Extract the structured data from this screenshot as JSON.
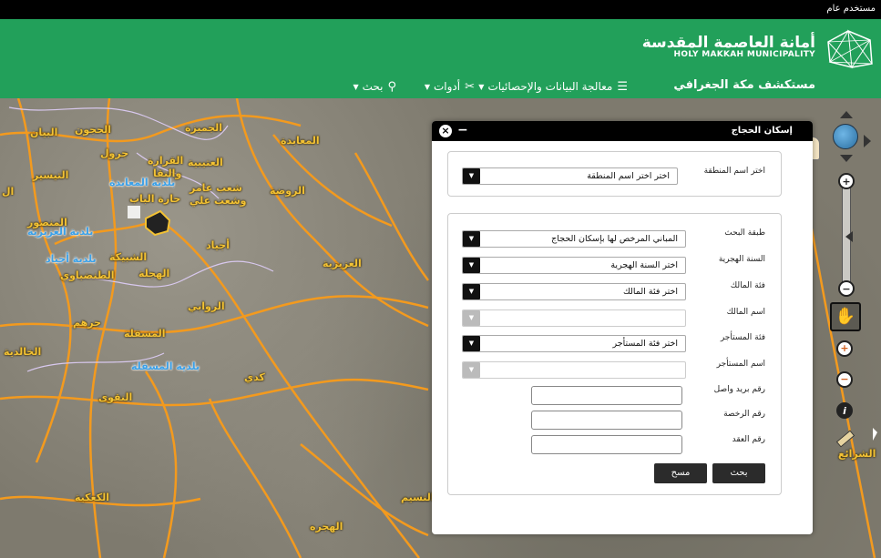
{
  "top_bar": {
    "user": "مستخدم عام"
  },
  "header": {
    "logo_ar": "أمانة العاصمة المقدسة",
    "logo_en": "HOLY MAKKAH MUNICIPALITY",
    "app_title": "مستكشف مكة الجغرافي",
    "nav": [
      {
        "label": "معالجة البيانات والإحصائيات",
        "icon": "database-icon"
      },
      {
        "label": "أدوات",
        "icon": "tools-icon"
      },
      {
        "label": "بحث",
        "icon": "search-icon"
      }
    ],
    "brand_color": "#22a05a"
  },
  "map": {
    "labels": [
      {
        "text": "الحجون"
      },
      {
        "text": "البيان"
      },
      {
        "text": "الجميزة"
      },
      {
        "text": "المعابدة"
      },
      {
        "text": "جرول"
      },
      {
        "text": "القرارة"
      },
      {
        "text": "والنقا"
      },
      {
        "text": "العتيبية"
      },
      {
        "text": "بلدية المعابدة"
      },
      {
        "text": "شعب عامر"
      },
      {
        "text": "وشعب علي"
      },
      {
        "text": "الروضة"
      },
      {
        "text": "التيسير"
      },
      {
        "text": "بلدية العزيزية"
      },
      {
        "text": "بلدية أجياد"
      },
      {
        "text": "حارة الباب"
      },
      {
        "text": "أجياد"
      },
      {
        "text": "المنصور"
      },
      {
        "text": "الشبيكة"
      },
      {
        "text": "الهجلة"
      },
      {
        "text": "الطنضباوي"
      },
      {
        "text": "العزيزية"
      },
      {
        "text": "الروابي"
      },
      {
        "text": "جرهم"
      },
      {
        "text": "المسفلة"
      },
      {
        "text": "بلدية المسفلة"
      },
      {
        "text": "كدي"
      },
      {
        "text": "الخالدية"
      },
      {
        "text": "النقوى"
      },
      {
        "text": "الكعكية"
      },
      {
        "text": "النسيم"
      },
      {
        "text": "الهجره"
      },
      {
        "text": "الشرائع"
      },
      {
        "text": "ال"
      }
    ]
  },
  "dialog": {
    "title": "إسكان الحجاج",
    "close": "×",
    "minimize": "−",
    "region": {
      "label": "اختر اسم المنطقة",
      "value": "اختر اختر اسم المنطقة"
    },
    "fields": [
      {
        "label": "طبقة البحث",
        "value": "المباني المرخص لها بإسكان الحجاج",
        "type": "select"
      },
      {
        "label": "السنة الهجرية",
        "value": "اختر السنة الهجرية",
        "type": "select"
      },
      {
        "label": "فئة المالك",
        "value": "اختر فئة المالك",
        "type": "select"
      },
      {
        "label": "اسم المالك",
        "value": "",
        "type": "select-disabled"
      },
      {
        "label": "فئة المستأجر",
        "value": "اختر فئة المستأجر",
        "type": "select"
      },
      {
        "label": "اسم المستأجر",
        "value": "",
        "type": "select-disabled"
      },
      {
        "label": "رقم بريد واصل",
        "value": "",
        "type": "text"
      },
      {
        "label": "رقم الرخصة",
        "value": "",
        "type": "text"
      },
      {
        "label": "رقم العقد",
        "value": "",
        "type": "text"
      }
    ],
    "buttons": {
      "search": "بحث",
      "clear": "مسح"
    }
  },
  "tools": {
    "zoom_in": "+",
    "zoom_out": "−",
    "info": "i"
  }
}
